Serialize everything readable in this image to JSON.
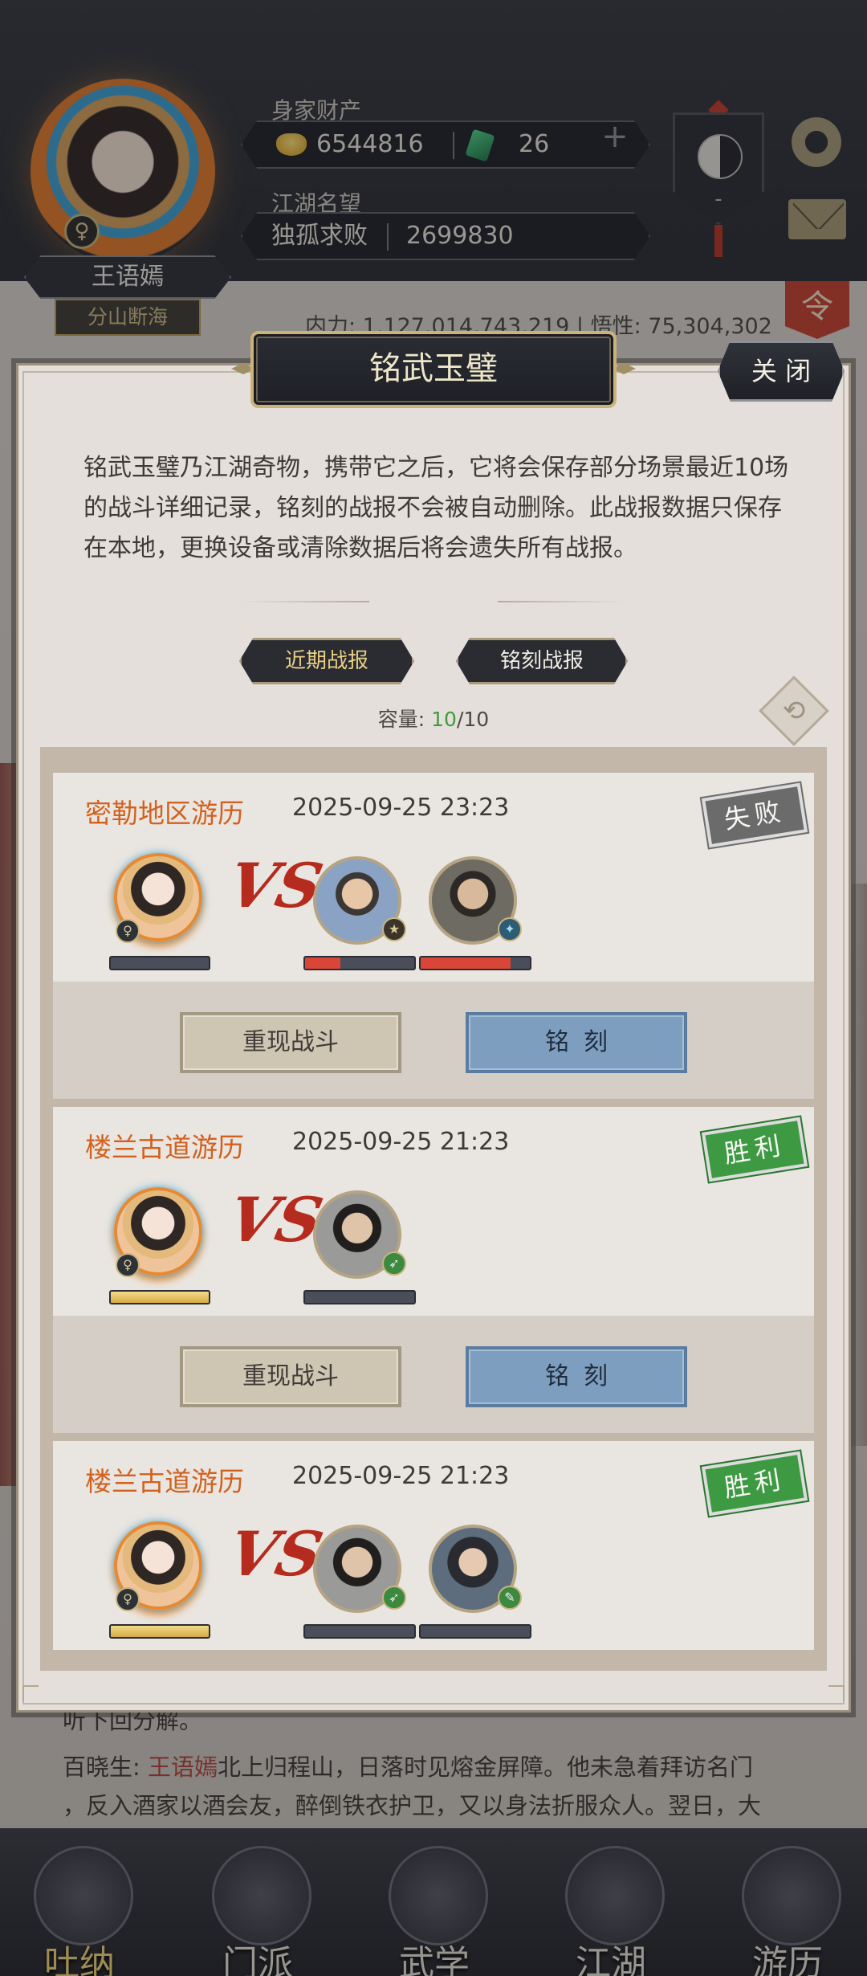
{
  "player": {
    "name": "王语嫣",
    "title": "分山断海",
    "gender_icon": "female-symbol-icon"
  },
  "resources": {
    "assets_label": "身家财产",
    "gold": "6544816",
    "jade": "26",
    "plus": "+",
    "fame_label": "江湖名望",
    "fame_title": "独孤求败",
    "fame_value": "2699830"
  },
  "header_icons": {
    "taiji_dash": "-",
    "settings": "gear-icon",
    "mail": "mail-icon",
    "order_button": "令"
  },
  "stats_line": "内力: 1,127,014,743,219  |  悟性: 75,304,302",
  "modal": {
    "title": "铭武玉璧",
    "close_label": "关 闭",
    "description": "铭武玉璧乃江湖奇物，携带它之后，它将会保存部分场景最近10场的战斗详细记录，铭刻的战报不会被自动删除。此战报数据只保存在本地，更换设备或清除数据后将会遗失所有战报。",
    "tabs": [
      {
        "label": "近期战报",
        "active": true
      },
      {
        "label": "铭刻战报",
        "active": false
      }
    ],
    "capacity_label": "容量: ",
    "capacity_used": "10",
    "capacity_total": "/10",
    "swap_icon": "⟲"
  },
  "battles": [
    {
      "location": "密勒地区游历",
      "time": "2025-09-25 23:23",
      "result": "失败",
      "replay_label": "重现战斗",
      "engrave_label": "铭刻",
      "vs": "VS",
      "player_hp": 0,
      "enemy_hp": [
        0.32,
        0.82
      ]
    },
    {
      "location": "楼兰古道游历",
      "time": "2025-09-25 21:23",
      "result": "胜利",
      "replay_label": "重现战斗",
      "engrave_label": "铭刻",
      "vs": "VS",
      "player_hp": 1.0,
      "enemy_hp": [
        0
      ]
    },
    {
      "location": "楼兰古道游历",
      "time": "2025-09-25 21:23",
      "result": "胜利",
      "vs": "VS",
      "player_hp": 1.0,
      "enemy_hp": [
        0,
        0
      ]
    }
  ],
  "story": {
    "line1": "听下回分解。",
    "speaker": "百晓生: ",
    "who": "王语嫣",
    "line2_rest": "北上归程山，日落时见熔金屏障。他未急着拜访名门",
    "line3": "，反入酒家以酒会友，醉倒铁衣护卫，又以身法折服众人。翌日，大"
  },
  "bottom_nav": [
    {
      "label": "吐纳",
      "active": true
    },
    {
      "label": "门派",
      "active": false
    },
    {
      "label": "武学",
      "active": false
    },
    {
      "label": "江湖",
      "active": false
    },
    {
      "label": "游历",
      "active": false
    }
  ]
}
